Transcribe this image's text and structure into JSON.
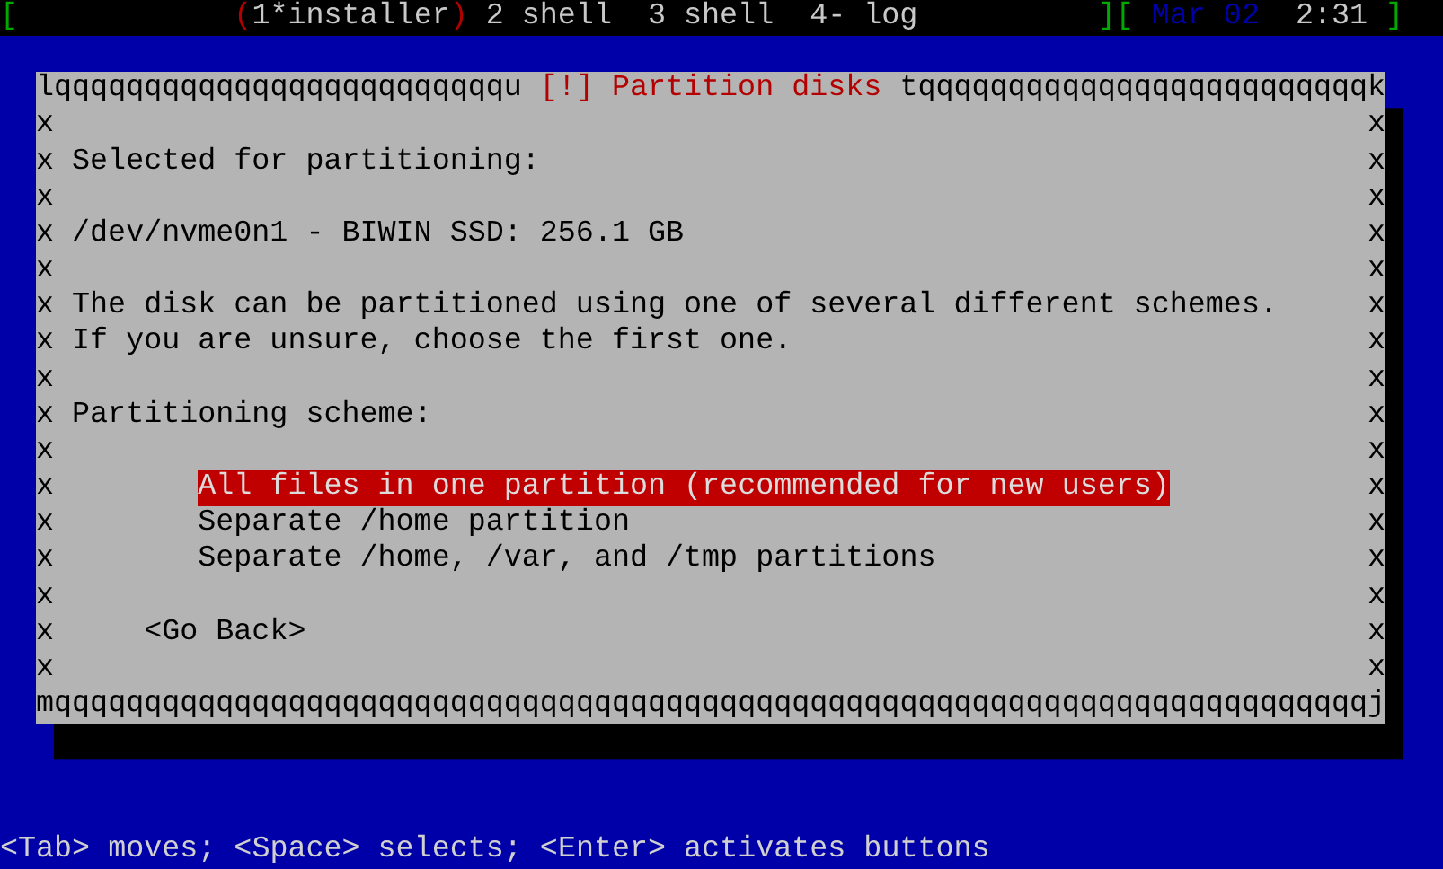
{
  "status_line": [
    {
      "text": "[",
      "color": "#00a800"
    },
    {
      "text": "(",
      "color": "#b40000"
    },
    {
      "text": "1*installer",
      "color": "#c8c8c8"
    },
    {
      "text": ")",
      "color": "#b40000"
    },
    {
      "text": "2 shell",
      "color": "#c8c8c8"
    },
    {
      "text": "3 shell",
      "color": "#c8c8c8"
    },
    {
      "text": "4- log",
      "color": "#c8c8c8"
    },
    {
      "text": "][",
      "color": "#00a800"
    },
    {
      "text": "Mar 02",
      "color": "#0000a8"
    },
    {
      "text": "2:31",
      "color": "#c8c8c8"
    },
    {
      "text": "]",
      "color": "#00a800"
    }
  ],
  "dialog": {
    "border_top_left": "lqqqqqqqqqqqqqqqqqqqqqqqqqu",
    "title": "[!] Partition disks",
    "border_top_right": "tqqqqqqqqqqqqqqqqqqqqqqqqqk",
    "rows": [
      {
        "kind": "blank",
        "left": "x",
        "right": "x"
      },
      {
        "kind": "text",
        "left": "x",
        "right": "x",
        "text": "Selected for partitioning:"
      },
      {
        "kind": "blank",
        "left": "x",
        "right": "x"
      },
      {
        "kind": "text",
        "left": "x",
        "right": "x",
        "text": "/dev/nvme0n1 - BIWIN SSD: 256.1 GB"
      },
      {
        "kind": "blank",
        "left": "x",
        "right": "x"
      },
      {
        "kind": "text",
        "left": "x",
        "right": "x",
        "text": "The disk can be partitioned using one of several different schemes."
      },
      {
        "kind": "text",
        "left": "x",
        "right": "x",
        "text": "If you are unsure, choose the first one."
      },
      {
        "kind": "blank",
        "left": "x",
        "right": "x"
      },
      {
        "kind": "text",
        "left": "x",
        "right": "x",
        "text": "Partitioning scheme:"
      },
      {
        "kind": "blank",
        "left": "x",
        "right": "x"
      },
      {
        "kind": "option",
        "left": "x",
        "right": "x",
        "text": "All files in one partition (recommended for new users)",
        "selected": true
      },
      {
        "kind": "option",
        "left": "x",
        "right": "x",
        "text": "Separate /home partition",
        "selected": false
      },
      {
        "kind": "option",
        "left": "x",
        "right": "x",
        "text": "Separate /home, /var, and /tmp partitions",
        "selected": false
      },
      {
        "kind": "blank",
        "left": "x",
        "right": "x"
      },
      {
        "kind": "button",
        "left": "x",
        "right": "x",
        "text": "<Go Back>"
      },
      {
        "kind": "blank",
        "left": "x",
        "right": "x"
      }
    ],
    "border_bottom": "mqqqqqqqqqqqqqqqqqqqqqqqqqqqqqqqqqqqqqqqqqqqqqqqqqqqqqqqqqqqqqqqqqqqqqqqqqj"
  },
  "help_line": "<Tab> moves; <Space> selects; <Enter> activates buttons"
}
